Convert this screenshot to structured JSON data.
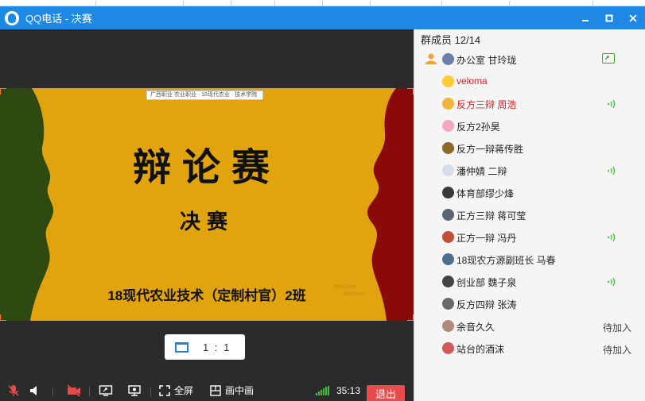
{
  "window": {
    "title": "QQ电话 - 决赛",
    "minimize_glyph": "▬",
    "maximize_glyph": "▣",
    "close_glyph": "✕"
  },
  "slide": {
    "top_banner": "广西职业 农业职业 · 18现代农业 · 技术学院",
    "title": "辩论赛",
    "subtitle": "决赛",
    "class_name": "18现代农业技术（定制村官）2班",
    "watermark_line1": "Windows",
    "watermark_line2": "Windows"
  },
  "ratio_button": {
    "label": "1 : 1"
  },
  "toolbar": {
    "fullscreen_label": "全屏",
    "pip_label": "画中画",
    "timer": "35:13",
    "exit_label": "退出"
  },
  "panel": {
    "header": "群成员 12/14",
    "members": [
      {
        "name": "办公室 甘玲珑",
        "color": "#222222",
        "avatar": "#6b7fa8",
        "indicator": "share"
      },
      {
        "name": "veloma",
        "color": "#e02020",
        "avatar": "#ffcc33",
        "indicator": ""
      },
      {
        "name": "反方三辩 周浩",
        "color": "#e02020",
        "avatar": "#f2b43a",
        "indicator": "speak"
      },
      {
        "name": "反方2孙昊",
        "color": "#222222",
        "avatar": "#f4a7c0",
        "indicator": ""
      },
      {
        "name": "反方一辩蒋传胜",
        "color": "#222222",
        "avatar": "#8a6a2a",
        "indicator": ""
      },
      {
        "name": "潘仲婧 二辩",
        "color": "#222222",
        "avatar": "#d6dde6",
        "indicator": "speak"
      },
      {
        "name": "体育部缪少烽",
        "color": "#222222",
        "avatar": "#3a3a3a",
        "indicator": ""
      },
      {
        "name": "正方三辩 蒋可莹",
        "color": "#222222",
        "avatar": "#5a6470",
        "indicator": ""
      },
      {
        "name": "正方一辩 冯丹",
        "color": "#222222",
        "avatar": "#c0503a",
        "indicator": "speak"
      },
      {
        "name": "18现农方源副班长 马春",
        "color": "#222222",
        "avatar": "#4f6f8f",
        "indicator": ""
      },
      {
        "name": "创业部 魏子泉",
        "color": "#222222",
        "avatar": "#444444",
        "indicator": "speak"
      },
      {
        "name": "反方四辩 张涛",
        "color": "#222222",
        "avatar": "#6a6a6a",
        "indicator": ""
      },
      {
        "name": "余音久久",
        "color": "#222222",
        "avatar": "#b08a7a",
        "indicator": "status",
        "status": "待加入"
      },
      {
        "name": "站台的酒沫",
        "color": "#222222",
        "avatar": "#d05a5a",
        "indicator": "status",
        "status": "待加入"
      }
    ]
  },
  "colors": {
    "titlebar": "#1e88e5",
    "slide_bg": "#e1a40f",
    "left_silhouette": "#2e4a10",
    "right_silhouette": "#8a0a0a",
    "exit_button": "#e84b4b",
    "speak_green": "#3fc13f"
  }
}
